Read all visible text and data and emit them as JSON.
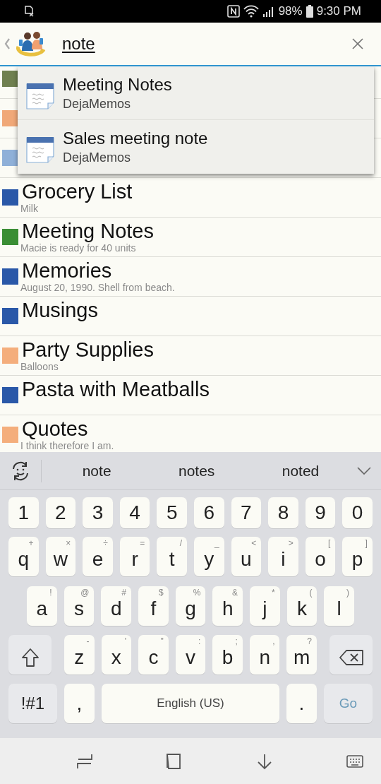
{
  "status_bar": {
    "battery": "98%",
    "time": "9:30 PM"
  },
  "search": {
    "value": "note"
  },
  "search_results": [
    {
      "title": "Meeting Notes",
      "source": "DejaMemos"
    },
    {
      "title": "Sales meeting note",
      "source": "DejaMemos"
    }
  ],
  "notes": [
    {
      "color": "#6f8050"
    },
    {
      "color": "#f0a878"
    },
    {
      "color": "#8fb0d8"
    },
    {
      "title": "Grocery List",
      "preview": "Milk",
      "color": "#2a58a8"
    },
    {
      "title": "Meeting Notes",
      "preview": "Macie is ready for 40 units",
      "color": "#3a8e34"
    },
    {
      "title": "Memories",
      "preview": "August 20, 1990. Shell from beach.",
      "color": "#2a58a8"
    },
    {
      "title": "Musings",
      "color": "#2a58a8"
    },
    {
      "title": "Party Supplies",
      "preview": "Balloons",
      "color": "#f4ae7c"
    },
    {
      "title": "Pasta with Meatballs",
      "color": "#2a58a8"
    },
    {
      "title": "Quotes",
      "preview": "I think therefore I am.",
      "color": "#f4ae7c"
    }
  ],
  "keyboard": {
    "suggestions": [
      "note",
      "notes",
      "noted"
    ],
    "number_row": [
      {
        "kind": "char",
        "label": "1"
      },
      {
        "kind": "char",
        "label": "2"
      },
      {
        "kind": "char",
        "label": "3"
      },
      {
        "kind": "char",
        "label": "4"
      },
      {
        "kind": "char",
        "label": "5"
      },
      {
        "kind": "char",
        "label": "6"
      },
      {
        "kind": "char",
        "label": "7"
      },
      {
        "kind": "char",
        "label": "8"
      },
      {
        "kind": "char",
        "label": "9"
      },
      {
        "kind": "char",
        "label": "0"
      }
    ],
    "upper_letter_row": [
      {
        "kind": "char",
        "label": "q",
        "hint": "+"
      },
      {
        "kind": "char",
        "label": "w",
        "hint": "×"
      },
      {
        "kind": "char",
        "label": "e",
        "hint": "÷"
      },
      {
        "kind": "char",
        "label": "r",
        "hint": "="
      },
      {
        "kind": "char",
        "label": "t",
        "hint": "/"
      },
      {
        "kind": "char",
        "label": "y",
        "hint": "_"
      },
      {
        "kind": "char",
        "label": "u",
        "hint": "<"
      },
      {
        "kind": "char",
        "label": "i",
        "hint": ">"
      },
      {
        "kind": "char",
        "label": "o",
        "hint": "["
      },
      {
        "kind": "char",
        "label": "p",
        "hint": "]"
      }
    ],
    "middle_letter_row": [
      {
        "kind": "char",
        "label": "a",
        "hint": "!"
      },
      {
        "kind": "char",
        "label": "s",
        "hint": "@"
      },
      {
        "kind": "char",
        "label": "d",
        "hint": "#"
      },
      {
        "kind": "char",
        "label": "f",
        "hint": "$"
      },
      {
        "kind": "char",
        "label": "g",
        "hint": "%"
      },
      {
        "kind": "char",
        "label": "h",
        "hint": "&"
      },
      {
        "kind": "char",
        "label": "j",
        "hint": "*"
      },
      {
        "kind": "char",
        "label": "k",
        "hint": "("
      },
      {
        "kind": "char",
        "label": "l",
        "hint": ")"
      }
    ],
    "lower_letter_row": [
      {
        "kind": "shift"
      },
      {
        "kind": "char",
        "label": "z",
        "hint": "-"
      },
      {
        "kind": "char",
        "label": "x",
        "hint": "'"
      },
      {
        "kind": "char",
        "label": "c",
        "hint": "\""
      },
      {
        "kind": "char",
        "label": "v",
        "hint": ":"
      },
      {
        "kind": "char",
        "label": "b",
        "hint": ";"
      },
      {
        "kind": "char",
        "label": "n",
        "hint": ","
      },
      {
        "kind": "char",
        "label": "m",
        "hint": "?"
      },
      {
        "kind": "backspace"
      }
    ],
    "function_row": [
      {
        "kind": "symbols",
        "label": "!#1"
      },
      {
        "kind": "char",
        "label": ","
      },
      {
        "kind": "space",
        "label": "English (US)"
      },
      {
        "kind": "char",
        "label": "."
      },
      {
        "kind": "go",
        "label": "Go"
      }
    ]
  }
}
